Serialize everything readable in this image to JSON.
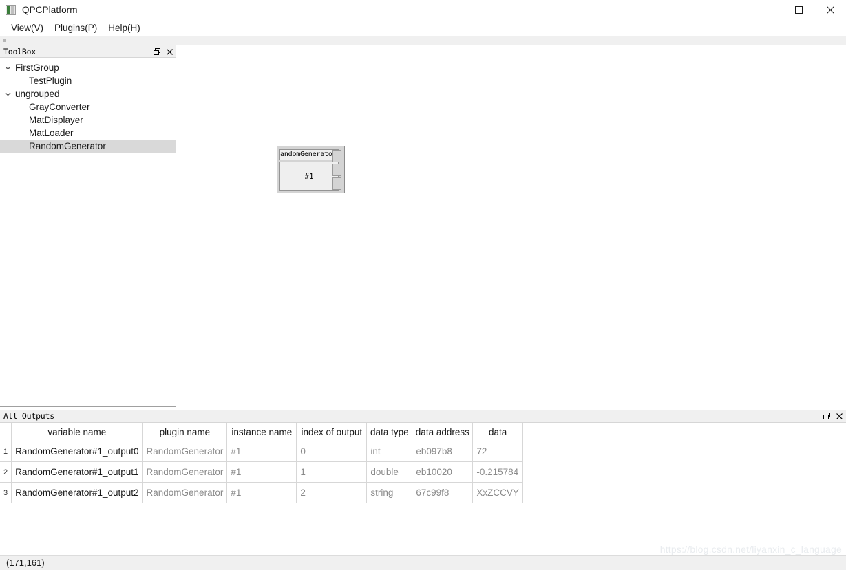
{
  "window": {
    "title": "QPCPlatform",
    "icon": "app-icon",
    "controls": {
      "minimize": "minimize-icon",
      "maximize": "maximize-icon",
      "close": "close-icon"
    }
  },
  "menubar": {
    "items": [
      {
        "label": "View(V)"
      },
      {
        "label": "Plugins(P)"
      },
      {
        "label": "Help(H)"
      }
    ]
  },
  "toolbox": {
    "title": "ToolBox",
    "buttons": {
      "float": "float-icon",
      "close": "close-icon"
    },
    "tree": [
      {
        "label": "FirstGroup",
        "type": "group",
        "expanded": true,
        "selected": false
      },
      {
        "label": "TestPlugin",
        "type": "child",
        "selected": false
      },
      {
        "label": "ungrouped",
        "type": "group",
        "expanded": true,
        "selected": false
      },
      {
        "label": "GrayConverter",
        "type": "child",
        "selected": false
      },
      {
        "label": "MatDisplayer",
        "type": "child",
        "selected": false
      },
      {
        "label": "MatLoader",
        "type": "child",
        "selected": false
      },
      {
        "label": "RandomGenerator",
        "type": "child",
        "selected": true
      }
    ]
  },
  "canvas": {
    "node": {
      "title": "andomGenerato",
      "instance": "#1",
      "ports": [
        "output-port-0",
        "output-port-1",
        "output-port-2"
      ]
    }
  },
  "outputs": {
    "title": "All Outputs",
    "buttons": {
      "float": "float-icon",
      "close": "close-icon"
    },
    "columns": [
      "variable name",
      "plugin name",
      "instance name",
      "index of output",
      "data type",
      "data address",
      "data"
    ],
    "rows": [
      {
        "num": "1",
        "variable_name": "RandomGenerator#1_output0",
        "plugin_name": "RandomGenerator",
        "instance_name": "#1",
        "index_of_output": "0",
        "data_type": "int",
        "data_address": "eb097b8",
        "data": "72"
      },
      {
        "num": "2",
        "variable_name": "RandomGenerator#1_output1",
        "plugin_name": "RandomGenerator",
        "instance_name": "#1",
        "index_of_output": "1",
        "data_type": "double",
        "data_address": "eb10020",
        "data": "-0.215784"
      },
      {
        "num": "3",
        "variable_name": "RandomGenerator#1_output2",
        "plugin_name": "RandomGenerator",
        "instance_name": "#1",
        "index_of_output": "2",
        "data_type": "string",
        "data_address": "67c99f8",
        "data": "XxZCCVY"
      }
    ]
  },
  "statusbar": {
    "coordinates": "(171,161)"
  },
  "watermark": {
    "text": "https://blog.csdn.net/liyanxin_c_language"
  },
  "colors": {
    "selection": "#d9d9d9",
    "panel_header": "#f0f0f0",
    "grid_line": "#d7d7d7",
    "muted_text": "#8a8a8a",
    "node_fill": "#d4d4d4"
  }
}
